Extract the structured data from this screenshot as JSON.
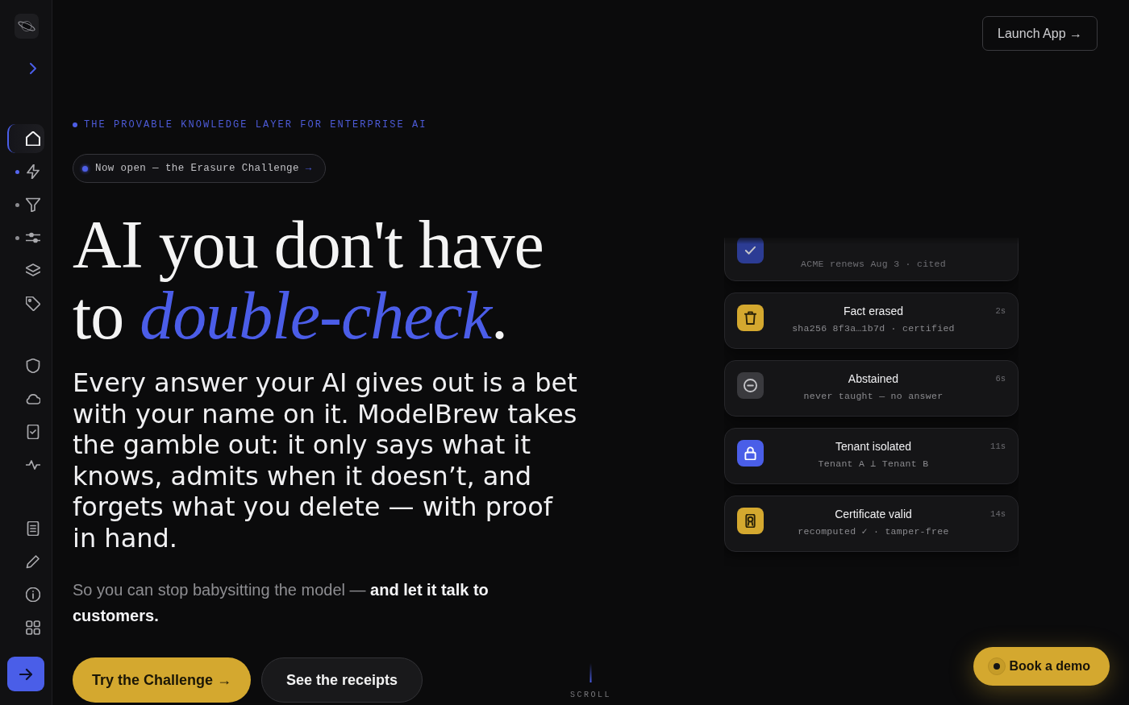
{
  "sidebar": {
    "groups": [
      {
        "items": [
          {
            "selected": true
          },
          {
            "selected": false,
            "color": "#5566ee"
          },
          {
            "selected": false,
            "color": "#8c8c90"
          },
          {
            "selected": false,
            "color": "#8c8c90"
          },
          {
            "selected": false
          },
          {
            "selected": false
          }
        ]
      },
      {
        "items": [
          {
            "selected": false
          },
          {
            "selected": false
          },
          {
            "selected": false
          },
          {
            "selected": false
          }
        ]
      },
      {
        "items": [
          {
            "selected": false
          },
          {
            "selected": false
          },
          {
            "selected": false
          },
          {
            "selected": false
          }
        ]
      }
    ]
  },
  "header": {
    "launch_button": "Launch App →"
  },
  "hero": {
    "eyebrow": "THE PROVABLE KNOWLEDGE LAYER FOR ENTERPRISE AI",
    "announcement": {
      "text": "Now open — the Erasure Challenge",
      "arrow": "→"
    },
    "title_lines": [
      "AI you don't have",
      "to *double-check*."
    ],
    "lead": "Every answer your AI gives out is a bet with your name on it. ModelBrew takes the gamble out: it only says what it knows, admits when it doesn’t, and forgets what you delete — with proof in hand.",
    "subtext": "So you can stop babysitting the model — **and let it talk to customers.**",
    "buttons": [
      {
        "label": "Try the Challenge →",
        "kind": "primary"
      },
      {
        "label": "See the receipts",
        "kind": "secondary"
      }
    ]
  },
  "scroll_hint": "SCROLL",
  "feed": {
    "cards": [
      {
        "subtitle": "ACME renews Aug 3 · cited",
        "color": "#2c3c94"
      },
      {
        "title": "Fact erased",
        "subtitle": "sha256 8f3a…1b7d · certified",
        "time": "2s",
        "color": "#d4a82f"
      },
      {
        "title": "Abstained",
        "subtitle": "never taught — no answer",
        "time": "6s",
        "color": "#3a3a3e"
      },
      {
        "title": "Tenant isolated",
        "subtitle": "Tenant A ⊥ Tenant B",
        "time": "11s",
        "color": "#4a5ee8"
      },
      {
        "title": "Certificate valid",
        "subtitle": "recomputed ✓ · tamper-free",
        "time": "14s",
        "color": "#d4a82f"
      }
    ]
  },
  "demo_button": "Book a demo"
}
